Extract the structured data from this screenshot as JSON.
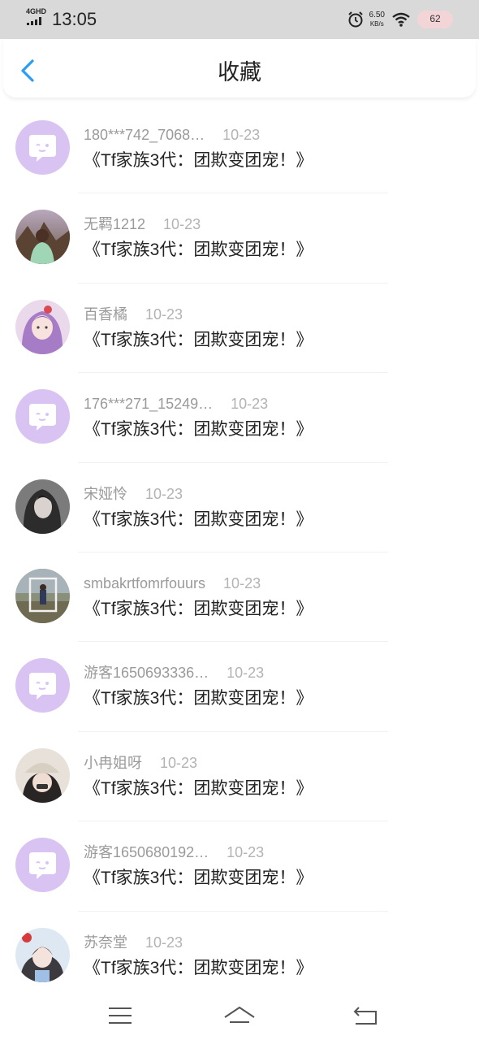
{
  "status_bar": {
    "network": "4GHD",
    "time": "13:05",
    "speed_value": "6.50",
    "speed_unit": "KB/s",
    "battery": "62"
  },
  "header": {
    "title": "收藏"
  },
  "favorites": [
    {
      "name": "180***742_7068…",
      "date": "10-23",
      "book": "《Tf家族3代：团欺变团宠！》",
      "avatar": "default-avatar-icon"
    },
    {
      "name": "无羁1212",
      "date": "10-23",
      "book": "《Tf家族3代：团欺变团宠！》",
      "avatar": "user-photo"
    },
    {
      "name": "百香橘",
      "date": "10-23",
      "book": "《Tf家族3代：团欺变团宠！》",
      "avatar": "user-photo"
    },
    {
      "name": "176***271_15249…",
      "date": "10-23",
      "book": "《Tf家族3代：团欺变团宠！》",
      "avatar": "default-avatar-icon"
    },
    {
      "name": "宋娅怜",
      "date": "10-23",
      "book": "《Tf家族3代：团欺变团宠！》",
      "avatar": "user-photo"
    },
    {
      "name": "smbakrtfomrfouurs",
      "date": "10-23",
      "book": "《Tf家族3代：团欺变团宠！》",
      "avatar": "user-photo"
    },
    {
      "name": "游客1650693336…",
      "date": "10-23",
      "book": "《Tf家族3代：团欺变团宠！》",
      "avatar": "default-avatar-icon"
    },
    {
      "name": "小冉姐呀",
      "date": "10-23",
      "book": "《Tf家族3代：团欺变团宠！》",
      "avatar": "user-photo"
    },
    {
      "name": "游客1650680192…",
      "date": "10-23",
      "book": "《Tf家族3代：团欺变团宠！》",
      "avatar": "default-avatar-icon"
    },
    {
      "name": "苏奈堂",
      "date": "10-23",
      "book": "《Tf家族3代：团欺变团宠！》",
      "avatar": "user-photo"
    }
  ],
  "colors": {
    "accent": "#2a9df4",
    "default_avatar_bg": "#d8c3f3"
  },
  "nav_icons": [
    "menu-icon",
    "home-icon",
    "back-icon"
  ]
}
